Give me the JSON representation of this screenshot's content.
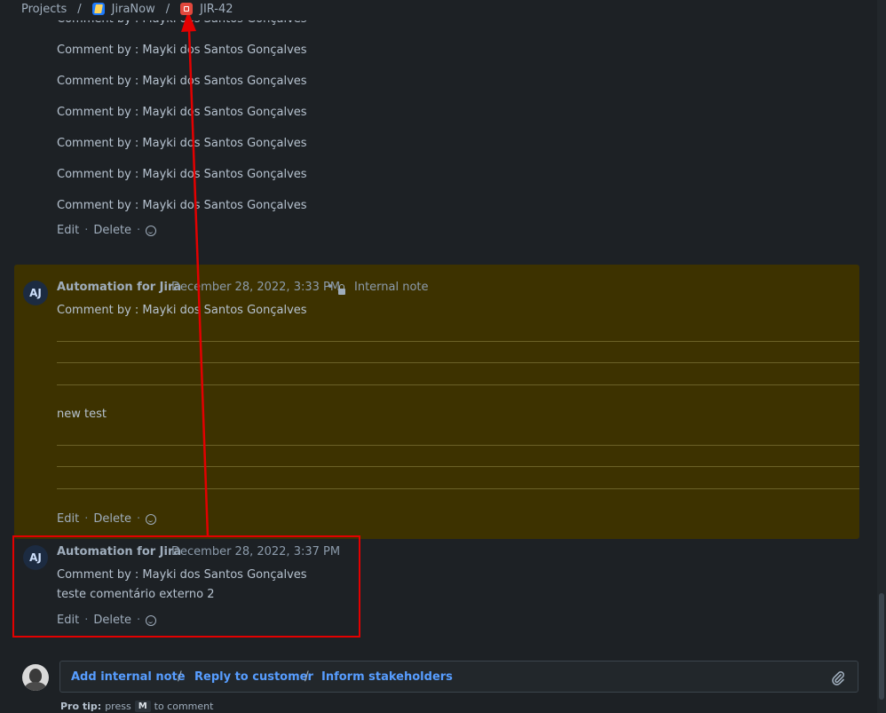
{
  "breadcrumb": {
    "projects": "Projects",
    "separator": "/",
    "project": "JiraNow",
    "issue": "JIR-42"
  },
  "top_comment": {
    "lines": [
      "Comment by : Mayki dos Santos Gonçalves",
      "Comment by : Mayki dos Santos Gonçalves",
      "Comment by : Mayki dos Santos Gonçalves",
      "Comment by : Mayki dos Santos Gonçalves",
      "Comment by : Mayki dos Santos Gonçalves",
      "Comment by : Mayki dos Santos Gonçalves",
      "Comment by : Mayki dos Santos Gonçalves"
    ]
  },
  "actions": {
    "edit": "Edit",
    "delete": "Delete",
    "dot": "·"
  },
  "internal_comment": {
    "avatar": "AJ",
    "author": "Automation for Jira",
    "date": "December 28, 2022, 3:33 PM",
    "bullet": "•",
    "visibility": "Internal note",
    "line1": "Comment by : Mayki dos Santos Gonçalves",
    "line2": "new test"
  },
  "external_comment": {
    "avatar": "AJ",
    "author": "Automation for Jira",
    "date": "December 28, 2022, 3:37 PM",
    "line1": "Comment by : Mayki dos Santos Gonçalves",
    "line2": "teste comentário externo 2"
  },
  "composer": {
    "add_internal_note": "Add internal note",
    "reply_to_customer": "Reply to customer",
    "inform_stakeholders": "Inform stakeholders",
    "separator": "/"
  },
  "protip": {
    "label": "Pro tip:",
    "press": "press",
    "key": "M",
    "suffix": "to comment"
  },
  "colors": {
    "highlight": "#e30000",
    "internal_note_bg": "#3d3200",
    "link": "#579dff",
    "background": "#1d2125"
  }
}
